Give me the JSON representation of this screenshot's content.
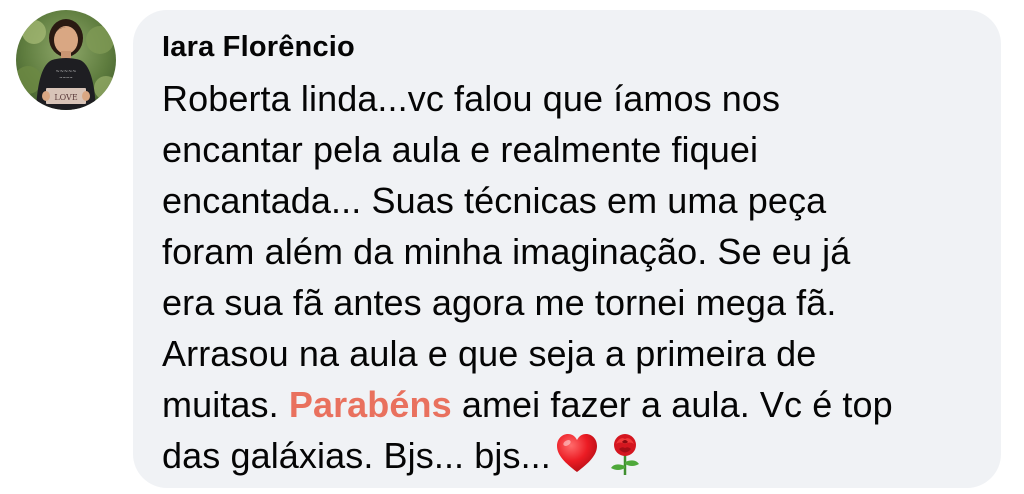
{
  "comment": {
    "author": "Iara Florêncio",
    "lines": [
      "Roberta linda...vc falou que íamos nos",
      "encantar pela aula e realmente fiquei",
      "encantada... Suas técnicas em uma peça",
      "foram além da minha imaginação.  Se eu já",
      "era sua fã antes agora me tornei mega fã.",
      "Arrasou na aula e que seja a primeira de"
    ],
    "line7_before": "muitas. ",
    "line7_highlight": "Parabéns",
    "line7_after": " amei fazer a aula. Vc é top",
    "line8": "das galáxias.  Bjs... bjs...",
    "avatar_sign_text": "LOVE",
    "emojis": [
      "heart-emoji",
      "rose-emoji"
    ],
    "colors": {
      "bubble_background": "#f0f2f5",
      "highlight": "#e9715e",
      "text": "#050505"
    }
  }
}
